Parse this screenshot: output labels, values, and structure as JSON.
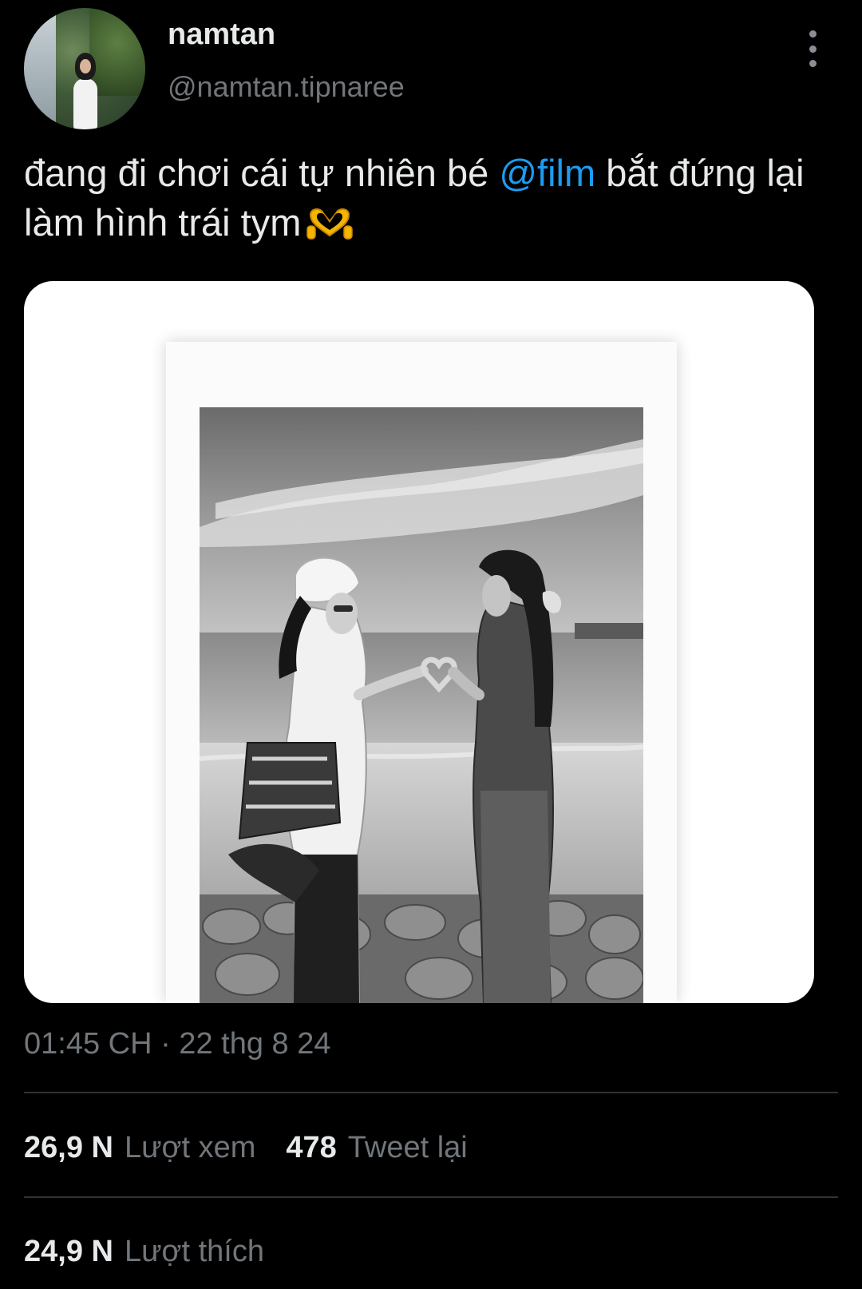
{
  "tweet": {
    "author": {
      "display_name": "namtan",
      "handle": "@namtan.tipnaree"
    },
    "text": {
      "part1": "đang đi chơi cái tự nhiên bé ",
      "mention": "@film",
      "part2": " bắt đứng lại làm hình trái tym",
      "emoji_icon": "heart-hands-icon"
    },
    "timestamp": "01:45 CH · 22 thg 8 24",
    "stats": {
      "views_count": "26,9 N",
      "views_label": "Lượt xem",
      "retweets_count": "478",
      "retweets_label": "Tweet lại",
      "likes_count": "24,9 N",
      "likes_label": "Lượt thích"
    }
  },
  "colors": {
    "background": "#000000",
    "text_primary": "#e7e9ea",
    "text_secondary": "#71767b",
    "link": "#1d9bf0",
    "divider": "#2f3336"
  },
  "icons": [
    "more-vertical-icon",
    "heart-hands-icon"
  ]
}
